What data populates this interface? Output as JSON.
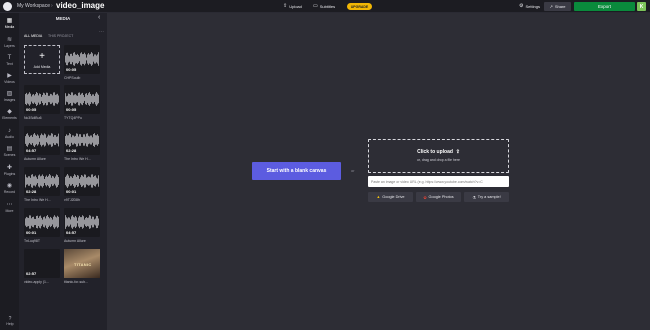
{
  "topbar": {
    "workspace": "My Workspace",
    "separator": "›",
    "project_title": "video_image",
    "upload": "Upload",
    "subtitles": "Subtitles",
    "upgrade": "UPGRADE",
    "settings": "Settings",
    "share": "Share",
    "export": "Export",
    "avatar": "K"
  },
  "rail": [
    {
      "label": "Media",
      "icon": "media-icon"
    },
    {
      "label": "Layers",
      "icon": "layers-icon"
    },
    {
      "label": "Text",
      "icon": "text-icon"
    },
    {
      "label": "Videos",
      "icon": "videos-icon"
    },
    {
      "label": "Images",
      "icon": "images-icon"
    },
    {
      "label": "Elements",
      "icon": "elements-icon"
    },
    {
      "label": "Audio",
      "icon": "audio-icon"
    },
    {
      "label": "Scenes",
      "icon": "scenes-icon"
    },
    {
      "label": "Plugins",
      "icon": "plugins-icon"
    },
    {
      "label": "Record",
      "icon": "record-icon"
    },
    {
      "label": "More",
      "icon": "more-icon"
    }
  ],
  "help": "Help",
  "panel": {
    "title": "MEDIA",
    "tab_all": "ALL MEDIA",
    "tab_project": "THIS PROJECT",
    "add_media": "Add Media",
    "items": [
      {
        "duration": "00:05",
        "name": "CHPSoulb"
      },
      {
        "duration": "00:05",
        "name": "Nc3SdlBu6"
      },
      {
        "duration": "00:05",
        "name": "TYTQ4PPu"
      },
      {
        "duration": "04:57",
        "name": "Autumn Allure"
      },
      {
        "duration": "02:28",
        "name": "The Intro We H..."
      },
      {
        "duration": "02:28",
        "name": "The Intro We H..."
      },
      {
        "duration": "00:01",
        "name": "v9TJ2D8h"
      },
      {
        "duration": "00:01",
        "name": "TnLuq98T"
      },
      {
        "duration": "04:57",
        "name": "Autumn Allure"
      },
      {
        "duration": "02:57",
        "name": "video-apply (1..."
      },
      {
        "duration": "",
        "name": "titanic-for-sub...",
        "thumb_text": "TITANIC"
      }
    ]
  },
  "main": {
    "blank_canvas": "Start with a blank canvas",
    "or": "or",
    "click_to_upload": "Click to upload",
    "drag_drop": "or, drag and drop a file here",
    "url_placeholder": "Paste an image or video URL (e.g. https://www.youtube.com/watch?v=C",
    "google_drive": "Google Drive",
    "google_photos": "Google Photos",
    "try_sample": "Try a sample!"
  }
}
